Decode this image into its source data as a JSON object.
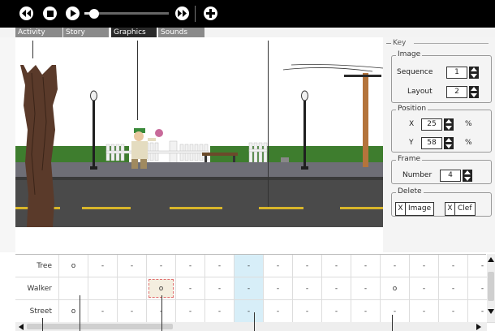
{
  "tabs": [
    {
      "label": "Activity",
      "active": false
    },
    {
      "label": "Story",
      "active": false
    },
    {
      "label": "Graphics",
      "active": true
    },
    {
      "label": "Sounds",
      "active": false
    }
  ],
  "toolbar": {
    "progress": 0.12
  },
  "key": {
    "title": "Key",
    "image": {
      "legend": "Image",
      "sequence_label": "Sequence",
      "sequence_value": "1",
      "layout_label": "Layout",
      "layout_value": "2"
    },
    "position": {
      "legend": "Position",
      "x_label": "X",
      "x_value": "25",
      "x_unit": "%",
      "y_label": "Y",
      "y_value": "58",
      "y_unit": "%"
    },
    "frame": {
      "legend": "Frame",
      "number_label": "Number",
      "number_value": "4"
    },
    "delete": {
      "legend": "Delete",
      "x_mark": "X",
      "image_label": "Image",
      "clef_label": "Clef"
    }
  },
  "grid": {
    "rows": [
      {
        "label": "Tree",
        "cells": [
          "o",
          "-",
          "-",
          "-",
          "-",
          "-",
          "-",
          "-",
          "-",
          "-",
          "-",
          "-",
          "-",
          "-",
          "-"
        ]
      },
      {
        "label": "Walker",
        "cells": [
          "",
          "",
          "",
          "o",
          "-",
          "-",
          "-",
          "-",
          "-",
          "-",
          "-",
          "o",
          "-",
          "-",
          "-"
        ]
      },
      {
        "label": "Street",
        "cells": [
          "o",
          "-",
          "-",
          "-",
          "-",
          "-",
          "-",
          "-",
          "-",
          "-",
          "-",
          "-",
          "-",
          "-",
          "-"
        ]
      }
    ],
    "selected_cell": {
      "row": 1,
      "col": 3
    },
    "highlight_col": 6
  },
  "colors": {
    "toolbar_bg": "#000000",
    "tab_active": "#2a2a2a",
    "tab_inactive": "#8a8a8a",
    "highlight_col": "#d7eef8",
    "selected_border": "#e07070",
    "road": "#4a4a4a",
    "hedge": "#3e7d2e",
    "sidewalk": "#6e6e76"
  },
  "icons": [
    "rewind-icon",
    "stop-icon",
    "play-icon",
    "fast-forward-icon",
    "add-icon",
    "scroll-up-arrow-icon",
    "scroll-down-arrow-icon",
    "scroll-left-arrow-icon",
    "scroll-right-arrow-icon"
  ]
}
